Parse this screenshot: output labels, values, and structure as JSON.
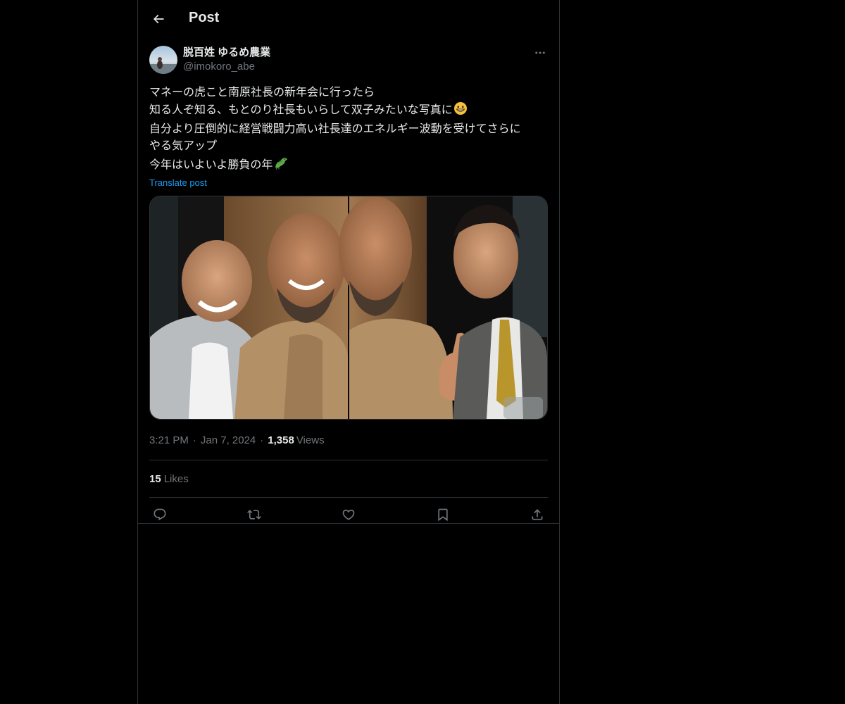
{
  "header": {
    "title": "Post",
    "back_icon": "arrow-left-icon"
  },
  "post": {
    "author": {
      "display_name": "脱百姓 ゆるめ農業",
      "handle": "@imokoro_abe"
    },
    "text_lines": [
      "マネーの虎こと南原社長の新年会に行ったら",
      "知る人ぞ知る、もとのり社長もいらして双子みたいな写真に",
      "自分より圧倒的に経営戦闘力高い社長達のエネルギー波動を受けてさらに",
      "やる気アップ",
      "今年はいよいよ勝負の年"
    ],
    "emojis": {
      "line_2": "grinning-face-emoji",
      "line_5": "dragon-emoji"
    },
    "translate_label": "Translate post",
    "media": {
      "description": "photo-collage-icon"
    },
    "time": "3:21 PM",
    "date": "Jan 7, 2024",
    "views_count": "1,358",
    "views_label": "Views",
    "likes_count": "15",
    "likes_label": "Likes"
  },
  "actions": {
    "reply_icon": "reply-icon",
    "repost_icon": "repost-icon",
    "like_icon": "heart-icon",
    "bookmark_icon": "bookmark-icon",
    "share_icon": "share-icon"
  },
  "colors": {
    "background": "#000000",
    "text_primary": "#e7e9ea",
    "text_secondary": "#71767b",
    "accent": "#1d9bf0",
    "border": "#2f3336"
  }
}
